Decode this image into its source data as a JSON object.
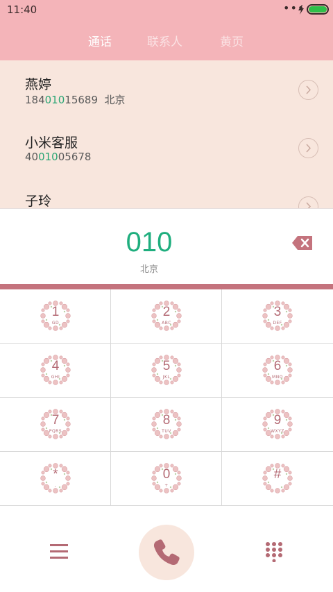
{
  "status_bar": {
    "time": "11:40",
    "dots": "•••"
  },
  "tabs": [
    {
      "label": "通话",
      "active": true
    },
    {
      "label": "联系人",
      "active": false
    },
    {
      "label": "黄页",
      "active": false
    }
  ],
  "results": [
    {
      "name": "燕婷",
      "number_pre": "184",
      "number_match": "010",
      "number_post": "15689",
      "location": "北京"
    },
    {
      "name": "小米客服",
      "number_pre": "40",
      "number_match": "010",
      "number_post": "05678",
      "location": ""
    },
    {
      "name": "子玲",
      "number_pre": "",
      "number_match": "",
      "number_post": "",
      "location": ""
    }
  ],
  "display": {
    "digits": "010",
    "location": "北京"
  },
  "keys": [
    {
      "digit": "1",
      "letters": "GD"
    },
    {
      "digit": "2",
      "letters": "ABC"
    },
    {
      "digit": "3",
      "letters": "DEF"
    },
    {
      "digit": "4",
      "letters": "GHI"
    },
    {
      "digit": "5",
      "letters": "JKL"
    },
    {
      "digit": "6",
      "letters": "MNO"
    },
    {
      "digit": "7",
      "letters": "PQRS"
    },
    {
      "digit": "8",
      "letters": "TUV"
    },
    {
      "digit": "9",
      "letters": "WXYZ"
    },
    {
      "digit": "*",
      "letters": ","
    },
    {
      "digit": "0",
      "letters": "+"
    },
    {
      "digit": "#",
      "letters": ""
    }
  ],
  "colors": {
    "header_pink": "#f4b4b9",
    "list_bg": "#f8e6dd",
    "accent_green": "#1fae7e",
    "key_rose": "#b46a74",
    "divider_rose": "#c4737d"
  },
  "icons": {
    "backspace": "backspace-icon",
    "menu": "menu-icon",
    "call": "phone-icon",
    "dialpad": "dialpad-icon",
    "chevron": "chevron-right-icon"
  }
}
